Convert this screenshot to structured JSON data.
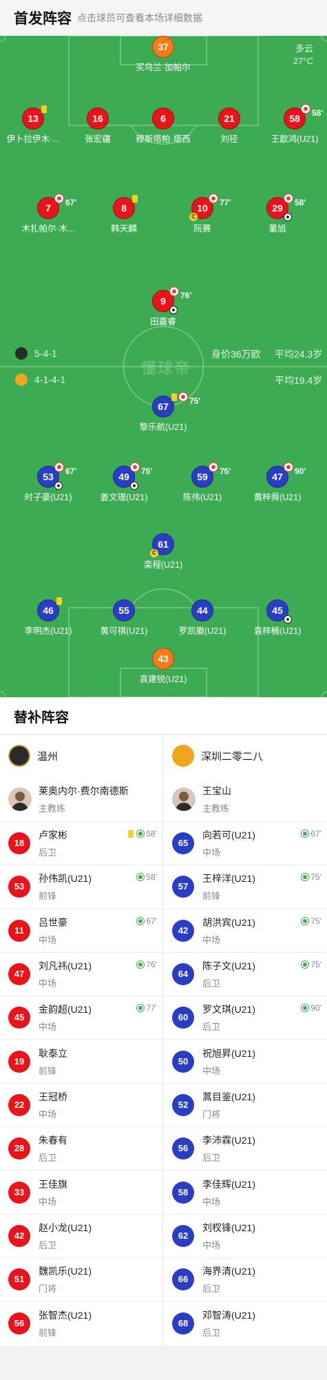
{
  "header": {
    "title": "首发阵容",
    "subtitle": "点击球员可查看本场详细数据"
  },
  "weather": {
    "condition": "多云",
    "temp": "27°C"
  },
  "home": {
    "formation": "5-4-1",
    "value": "身价36万欧",
    "avg_age": "平均24.3岁",
    "color": "#e8141a",
    "players": [
      {
        "num": "37",
        "name": "买乌兰·加帕尔",
        "gk": true
      },
      {
        "num": "13",
        "name": "伊卜拉伊木·...",
        "yellow": true
      },
      {
        "num": "16",
        "name": "张宏疆"
      },
      {
        "num": "6",
        "name": "穆斯塔帕·塔西"
      },
      {
        "num": "21",
        "name": "刘径"
      },
      {
        "num": "58",
        "name": "王歆鸿(U21)",
        "subbed": "58'"
      },
      {
        "num": "7",
        "name": "木扎帕尔·木...",
        "subbed": "67'"
      },
      {
        "num": "8",
        "name": "韩天麟",
        "yellow": true
      },
      {
        "num": "10",
        "name": "阮赛",
        "subbed": "77'",
        "captain": "C"
      },
      {
        "num": "29",
        "name": "董旭",
        "subbed": "58'",
        "goal": true
      },
      {
        "num": "9",
        "name": "田嘉睿",
        "subbed": "76'",
        "goal": true
      }
    ]
  },
  "away": {
    "formation": "4-1-4-1",
    "avg_age": "平均19.4岁",
    "color": "#2a3ec4",
    "players": [
      {
        "num": "67",
        "name": "黎乐航(U21)",
        "yellow": true,
        "subbed": "75'"
      },
      {
        "num": "53",
        "name": "时子豪(U21)",
        "subbed": "67'",
        "goal": true
      },
      {
        "num": "49",
        "name": "姜文璟(U21)",
        "subbed": "75'",
        "goal": true
      },
      {
        "num": "59",
        "name": "陈伟(U21)",
        "subbed": "75'"
      },
      {
        "num": "47",
        "name": "黄梓舜(U21)",
        "subbed": "90'"
      },
      {
        "num": "61",
        "name": "栾程(U21)",
        "captain": "C"
      },
      {
        "num": "46",
        "name": "李明杰(U21)",
        "yellow": true
      },
      {
        "num": "55",
        "name": "黄可祺(U21)"
      },
      {
        "num": "44",
        "name": "罗凯徽(U21)"
      },
      {
        "num": "45",
        "name": "袁梓楠(U21)",
        "goal": true
      },
      {
        "num": "43",
        "name": "袁建锐(U21)",
        "gk": true
      }
    ]
  },
  "watermark": "懂球帝",
  "subs": {
    "title": "替补阵容",
    "left": {
      "team": "温州",
      "coach_name": "莱奥内尔·费尔南德斯",
      "coach_role": "主教练",
      "players": [
        {
          "num": "18",
          "name": "卢家彬",
          "pos": "后卫",
          "yellow": true,
          "in": "58'"
        },
        {
          "num": "53",
          "name": "孙伟凯(U21)",
          "pos": "前锋",
          "in": "58'"
        },
        {
          "num": "11",
          "name": "吕世豪",
          "pos": "中场",
          "in": "67'"
        },
        {
          "num": "47",
          "name": "刘凡祎(U21)",
          "pos": "中场",
          "in": "76'"
        },
        {
          "num": "45",
          "name": "金韵超(U21)",
          "pos": "中场",
          "in": "77'"
        },
        {
          "num": "19",
          "name": "耿泰立",
          "pos": "前锋"
        },
        {
          "num": "22",
          "name": "王冠桥",
          "pos": "中场"
        },
        {
          "num": "28",
          "name": "朱春有",
          "pos": "后卫"
        },
        {
          "num": "33",
          "name": "王佳旗",
          "pos": "中场"
        },
        {
          "num": "42",
          "name": "赵小龙(U21)",
          "pos": "后卫"
        },
        {
          "num": "51",
          "name": "魏凯乐(U21)",
          "pos": "门将"
        },
        {
          "num": "56",
          "name": "张智杰(U21)",
          "pos": "前锋"
        }
      ]
    },
    "right": {
      "team": "深圳二零二八",
      "coach_name": "王宝山",
      "coach_role": "主教练",
      "players": [
        {
          "num": "65",
          "name": "向若可(U21)",
          "pos": "中场",
          "in": "67'"
        },
        {
          "num": "57",
          "name": "王梓洋(U21)",
          "pos": "前锋",
          "in": "75'"
        },
        {
          "num": "42",
          "name": "胡洪宾(U21)",
          "pos": "中场",
          "in": "75'"
        },
        {
          "num": "64",
          "name": "陈子文(U21)",
          "pos": "后卫",
          "in": "75'"
        },
        {
          "num": "60",
          "name": "罗文琪(U21)",
          "pos": "后卫",
          "in": "90'"
        },
        {
          "num": "50",
          "name": "祝旭昇(U21)",
          "pos": "中场"
        },
        {
          "num": "52",
          "name": "蒿目鉴(U21)",
          "pos": "门将"
        },
        {
          "num": "56",
          "name": "李沛霖(U21)",
          "pos": "后卫"
        },
        {
          "num": "58",
          "name": "李佳辉(U21)",
          "pos": "中场"
        },
        {
          "num": "62",
          "name": "刘杈锋(U21)",
          "pos": "中场"
        },
        {
          "num": "66",
          "name": "海界清(U21)",
          "pos": "后卫"
        },
        {
          "num": "68",
          "name": "邓智涛(U21)",
          "pos": "后卫"
        }
      ]
    }
  }
}
